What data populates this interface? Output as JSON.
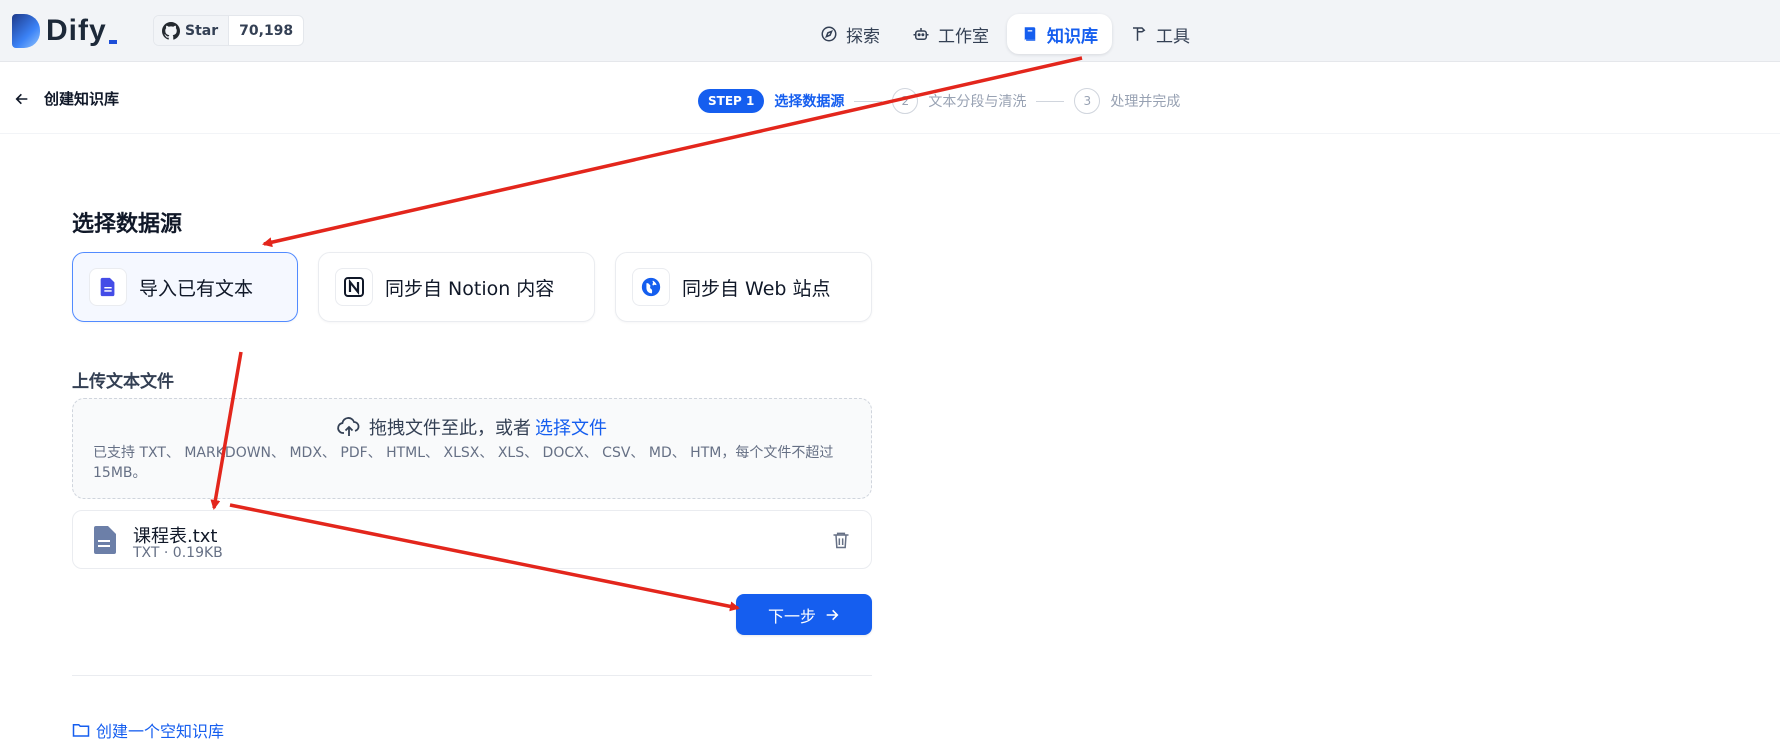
{
  "header": {
    "logo_text": "Dify",
    "github": {
      "star_label": "Star",
      "star_count": "70,198"
    },
    "nav": [
      {
        "label": "探索",
        "icon": "compass-icon"
      },
      {
        "label": "工作室",
        "icon": "robot-icon"
      },
      {
        "label": "知识库",
        "icon": "book-icon",
        "active": true
      },
      {
        "label": "工具",
        "icon": "hammer-icon"
      }
    ]
  },
  "subheader": {
    "back_label": "创建知识库",
    "steps": [
      {
        "badge": "STEP 1",
        "label": "选择数据源",
        "active": true
      },
      {
        "number": "2",
        "label": "文本分段与清洗"
      },
      {
        "number": "3",
        "label": "处理并完成"
      }
    ]
  },
  "main": {
    "section_title": "选择数据源",
    "sources": [
      {
        "label": "导入已有文本",
        "icon": "document-icon",
        "active": true
      },
      {
        "label": "同步自 Notion 内容",
        "icon": "notion-icon"
      },
      {
        "label": "同步自 Web 站点",
        "icon": "globe-icon"
      }
    ],
    "upload_label": "上传文本文件",
    "dropzone": {
      "text": "拖拽文件至此，或者",
      "link": "选择文件",
      "hint": "已支持 TXT、 MARKDOWN、 MDX、 PDF、 HTML、 XLSX、 XLS、 DOCX、 CSV、 MD、 HTM，每个文件不超过 15MB。"
    },
    "file": {
      "name": "课程表.txt",
      "meta": "TXT · 0.19KB"
    },
    "next_label": "下一步",
    "empty_link": "创建一个空知识库"
  },
  "colors": {
    "accent": "#155eef",
    "annotation": "#e3261c"
  }
}
